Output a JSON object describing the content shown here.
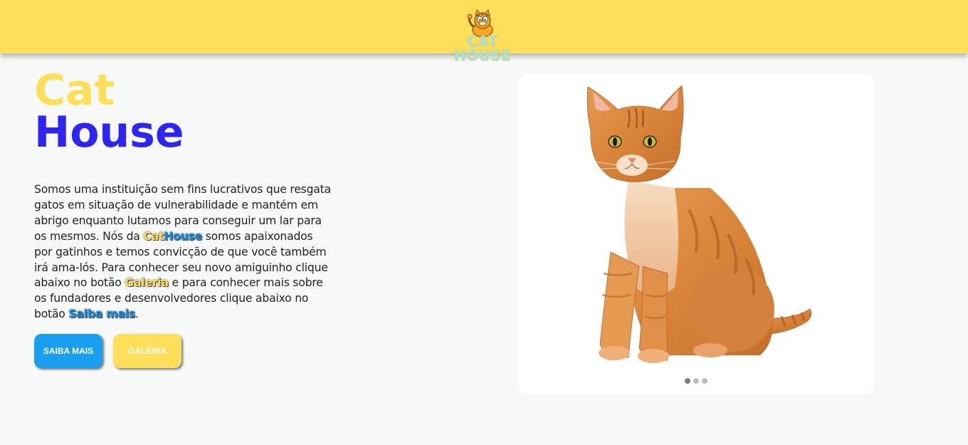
{
  "header": {
    "logo": {
      "line1": "CAT",
      "line2": "HOUSE"
    }
  },
  "hero": {
    "title_line1": "Cat",
    "title_line2": "House",
    "description": {
      "p1": "Somos uma instituição sem fins lucrativos que resgata gatos em situação de vulnerabilidade e mantém em abrigo enquanto lutamos para conseguir um lar para os mesmos. Nós da ",
      "brand_a": "Cat",
      "brand_b": "House",
      "p2": " somos apaixonados por gatinhos e temos convicção de que você também irá ama-lós. Para conhecer seu novo amiguinho clique abaixo no botão ",
      "galeria_link": "Galeria",
      "p3": " e para conhecer mais sobre os fundadores e desenvolvedores clique abaixo no botão ",
      "saiba_link": "Saiba mais",
      "p4": "."
    }
  },
  "buttons": {
    "saiba_mais": "SAIBA MAIS",
    "galeria": "GALERIA"
  },
  "carousel": {
    "slide_count": 3,
    "active_slide": 1
  },
  "colors": {
    "header_bg": "#ffde59",
    "accent_yellow": "#ffde59",
    "accent_blue": "#2e25f2",
    "button_blue": "#1a9ef0",
    "page_bg": "#f7f9f8"
  }
}
